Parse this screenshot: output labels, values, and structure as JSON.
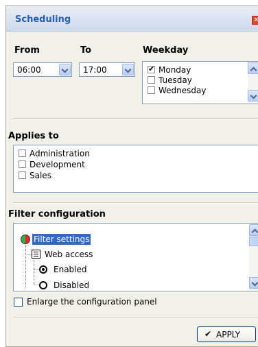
{
  "panel": {
    "title": "Scheduling"
  },
  "schedule": {
    "from_label": "From",
    "from_value": "06:00",
    "to_label": "To",
    "to_value": "17:00",
    "weekday_label": "Weekday",
    "weekdays": [
      {
        "label": "Monday",
        "checked": true
      },
      {
        "label": "Tuesday",
        "checked": false
      },
      {
        "label": "Wednesday",
        "checked": false
      }
    ]
  },
  "applies_to": {
    "label": "Applies to",
    "items": [
      {
        "label": "Administration",
        "checked": false
      },
      {
        "label": "Development",
        "checked": false
      },
      {
        "label": "Sales",
        "checked": false
      }
    ]
  },
  "filter": {
    "label": "Filter configuration",
    "tree": {
      "root": "Filter settings",
      "child": "Web access",
      "options": [
        {
          "label": "Enabled",
          "selected": true
        },
        {
          "label": "Disabled",
          "selected": false
        }
      ]
    }
  },
  "enlarge": {
    "label": "Enlarge the configuration panel",
    "checked": false
  },
  "apply": {
    "label": "APPLY"
  }
}
